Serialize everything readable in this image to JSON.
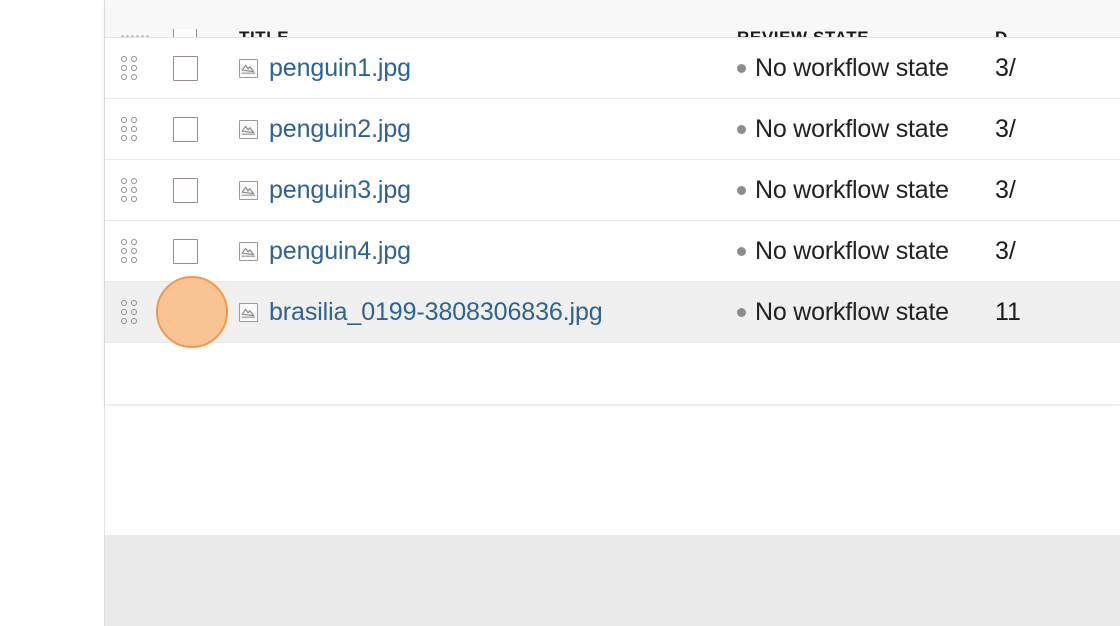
{
  "table": {
    "columns": [
      {
        "key": "handle",
        "label": "",
        "icon": "drag-handle-icon"
      },
      {
        "key": "select",
        "label": "",
        "icon": "checkbox-icon"
      },
      {
        "key": "title",
        "label": "TITLE"
      },
      {
        "key": "review_state",
        "label": "REVIEW STATE"
      },
      {
        "key": "date",
        "label": "D"
      }
    ],
    "rows": [
      {
        "title": "penguin1.jpg",
        "icon": "image-file-icon",
        "review_state": "No workflow state",
        "state_dot_color": "#8d8d8d",
        "date": "3/",
        "selected": false,
        "highlighted": false
      },
      {
        "title": "penguin2.jpg",
        "icon": "image-file-icon",
        "review_state": "No workflow state",
        "state_dot_color": "#8d8d8d",
        "date": "3/",
        "selected": false,
        "highlighted": false
      },
      {
        "title": "penguin3.jpg",
        "icon": "image-file-icon",
        "review_state": "No workflow state",
        "state_dot_color": "#8d8d8d",
        "date": "3/",
        "selected": false,
        "highlighted": false
      },
      {
        "title": "penguin4.jpg",
        "icon": "image-file-icon",
        "review_state": "No workflow state",
        "state_dot_color": "#8d8d8d",
        "date": "3/",
        "selected": false,
        "highlighted": false
      },
      {
        "title": "brasilia_0199-3808306836.jpg",
        "icon": "image-file-icon",
        "review_state": "No workflow state",
        "state_dot_color": "#8d8d8d",
        "date": "11",
        "selected": false,
        "highlighted": true
      }
    ]
  },
  "cursor_highlight": {
    "target": "row-checkbox-brasilia",
    "fill_color": "#f9c493",
    "ring_color": "#ef9a4f"
  },
  "colors": {
    "link": "#2e6295",
    "header_background": "#f8f8f8",
    "row_highlight": "#f0f0f0",
    "footer_band": "#eaeaea",
    "scrollbar_thumb": "#c8dcec",
    "checkbox_border": "#9a8d8d"
  }
}
